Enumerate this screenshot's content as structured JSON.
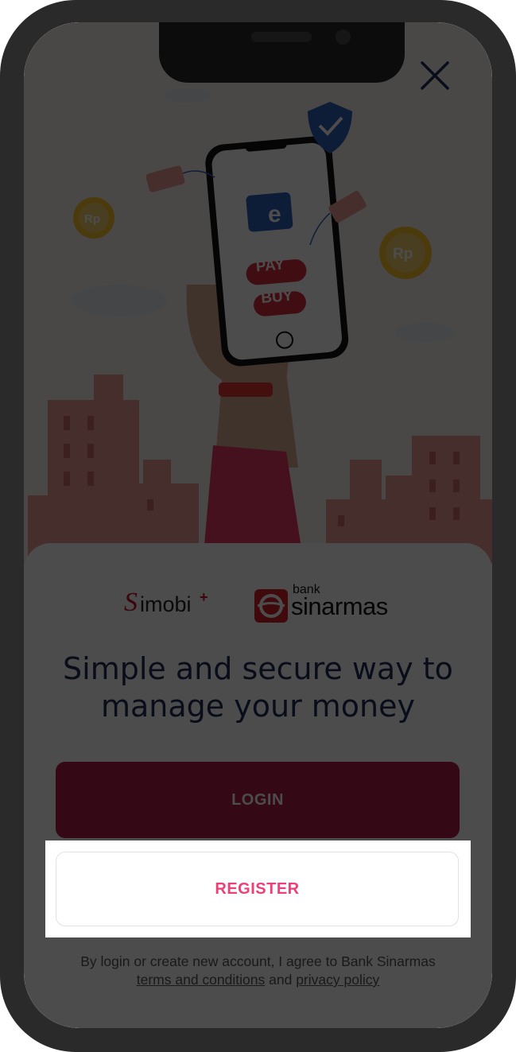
{
  "app": {
    "brand_left": "Simobi",
    "brand_left_plus": "+",
    "bank_small": "bank",
    "bank_name": "sinarmas"
  },
  "hero": {
    "wallet_letter": "e",
    "pay_label": "PAY",
    "buy_label": "BUY",
    "coin_label": "Rp"
  },
  "headline": "Simple and secure way to manage your money",
  "buttons": {
    "login": "LOGIN",
    "register": "REGISTER"
  },
  "legal": {
    "prefix": "By login or create new account, I agree to Bank Sinarmas",
    "terms": "terms and conditions",
    "and": "and",
    "privacy": "privacy policy"
  },
  "colors": {
    "primary": "#ad1d49",
    "accent": "#ee3f77",
    "headline": "#1f2d54",
    "frame": "#2b2a2a"
  },
  "icons": [
    "close-icon",
    "shield-check-icon",
    "wallet-icon",
    "coin-icon",
    "price-tag-icon"
  ]
}
